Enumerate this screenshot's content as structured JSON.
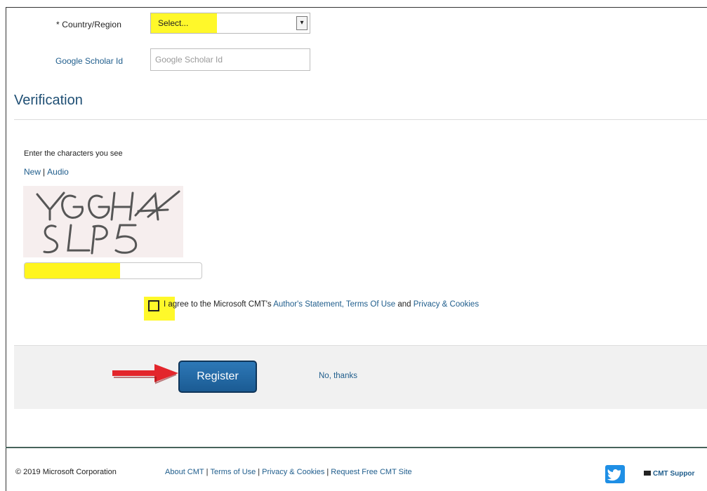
{
  "form": {
    "country_label": "* Country/Region",
    "country_selected": "Select...",
    "google_scholar_label": "Google Scholar Id",
    "google_scholar_placeholder": "Google Scholar Id",
    "google_scholar_value": ""
  },
  "verification": {
    "title": "Verification",
    "prompt": "Enter the characters you see",
    "new_link": "New",
    "separator": "|",
    "audio_link": "Audio",
    "captcha_image_text": "YGGH4 SLP5",
    "captcha_input_fill_fraction": 0.54
  },
  "agreement": {
    "text": "I agree to the Microsoft CMT's",
    "authors_statement": "Author's Statement,",
    "terms_of_use": "Terms Of Use",
    "and": "and",
    "privacy_cookies": "Privacy & Cookies"
  },
  "actions": {
    "register_label": "Register",
    "no_thanks_label": "No, thanks"
  },
  "footer": {
    "copyright": "© 2019 Microsoft Corporation",
    "about": "About CMT",
    "terms": "Terms of Use",
    "privacy": "Privacy & Cookies",
    "request": "Request Free CMT Site",
    "separator": "|",
    "support": "CMT Suppor"
  },
  "colors": {
    "highlight": "#fff82a",
    "link": "#1f5d8c",
    "register_button": "#1b5b93",
    "twitter_blue": "#1f8fe5",
    "pointer_arrow": "#e3262c"
  },
  "icons": {
    "dropdown": "chevron-down-icon",
    "pointer": "red-arrow-icon",
    "social": "twitter-icon",
    "support": "mail-icon"
  }
}
